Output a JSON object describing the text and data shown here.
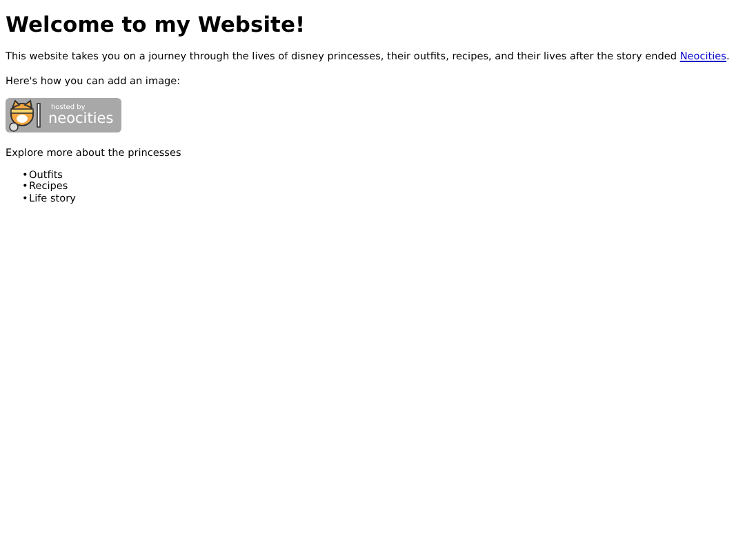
{
  "heading": "Welcome to my Website!",
  "intro": {
    "text": "This website takes you on a journey through the lives of disney princesses, their outfits, recipes, and their lives after the story ended ",
    "link": "Neocities",
    "end": "."
  },
  "image_note": "Here's how you can add an image:",
  "badge": {
    "small": "hosted by",
    "big": "neocities"
  },
  "explore": "Explore more about the princesses",
  "items": [
    {
      "marker": "•",
      "text": "Outfits"
    },
    {
      "marker": "•",
      "text": "Recipes"
    },
    {
      "marker": "•",
      "text": "Life story"
    }
  ]
}
